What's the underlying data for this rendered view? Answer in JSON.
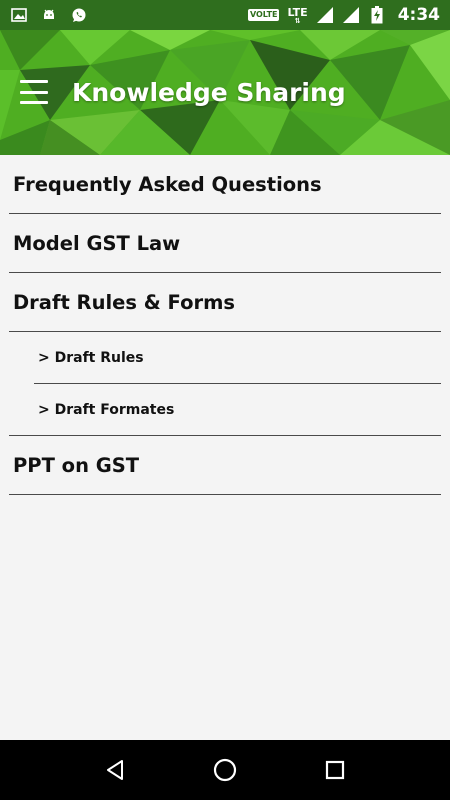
{
  "status_bar": {
    "network_badge": "VOLTE",
    "network_type": "LTE",
    "time": "4:34"
  },
  "app_bar": {
    "title": "Knowledge Sharing"
  },
  "menu": {
    "items": [
      {
        "label": "Frequently Asked Questions"
      },
      {
        "label": "Model GST Law"
      },
      {
        "label": "Draft Rules & Forms"
      }
    ],
    "sub_items": [
      {
        "label": "> Draft Rules"
      },
      {
        "label": "> Draft Formates"
      }
    ],
    "last_item": {
      "label": "PPT on GST"
    }
  },
  "colors": {
    "status_bar": "#2f6e1e",
    "app_bar_green": "#4da823",
    "background": "#f4f4f4",
    "text": "#111111",
    "divider": "#4a4a4a",
    "nav_bar": "#000000"
  }
}
